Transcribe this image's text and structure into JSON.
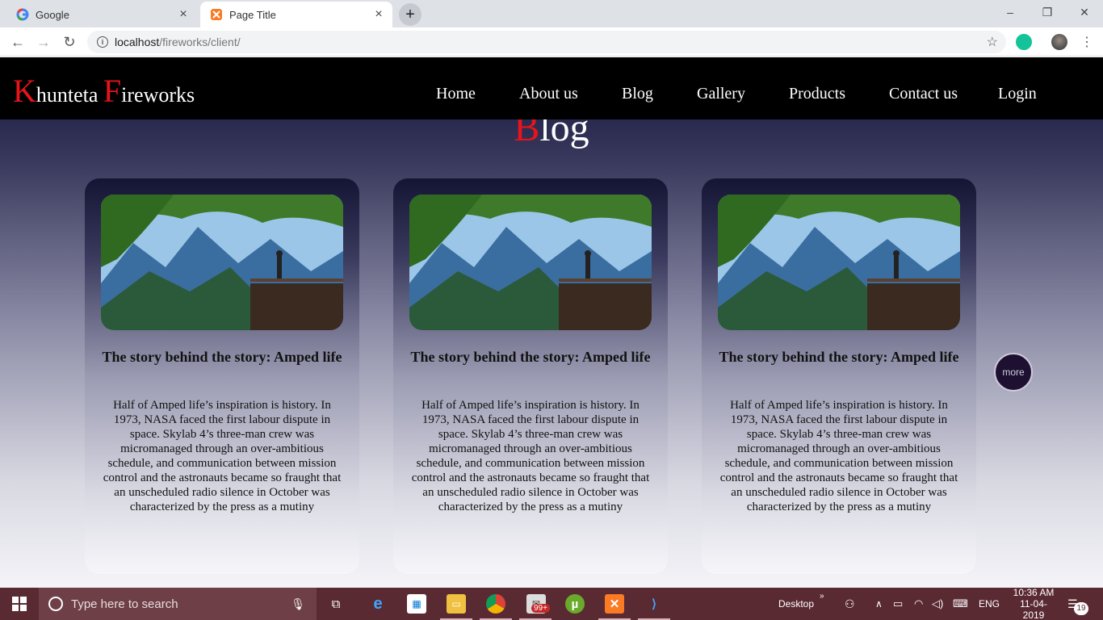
{
  "browser": {
    "tabs": [
      {
        "title": "Google",
        "favicon": "google-favicon",
        "close": "×"
      },
      {
        "title": "Page Title",
        "favicon": "xampp-favicon",
        "close": "×"
      }
    ],
    "new_tab": "+",
    "address": {
      "host": "localhost",
      "path": "/fireworks/client/"
    },
    "window_controls": {
      "minimize": "–",
      "restore": "❐",
      "close": "✕"
    }
  },
  "site": {
    "brand": {
      "k": "K",
      "rest1": "hunteta ",
      "f": "F",
      "rest2": "ireworks"
    },
    "nav": [
      "Home",
      "About us",
      "Blog",
      "Gallery",
      "Products",
      "Contact us",
      "Login"
    ],
    "section_title": {
      "first": "B",
      "rest": "log"
    },
    "cards": [
      {
        "title": "The story behind the story: Amped life",
        "body": "Half of Amped life’s inspiration is history. In 1973, NASA faced the first labour dispute in space. Skylab 4’s three-man crew was micromanaged through an over-ambitious schedule, and communication between mission control and the astronauts became so fraught that an unscheduled radio silence in October was characterized by the press as a mutiny"
      },
      {
        "title": "The story behind the story: Amped life",
        "body": "Half of Amped life’s inspiration is history. In 1973, NASA faced the first labour dispute in space. Skylab 4’s three-man crew was micromanaged through an over-ambitious schedule, and communication between mission control and the astronauts became so fraught that an unscheduled radio silence in October was characterized by the press as a mutiny"
      },
      {
        "title": "The story behind the story: Amped life",
        "body": "Half of Amped life’s inspiration is history. In 1973, NASA faced the first labour dispute in space. Skylab 4’s three-man crew was micromanaged through an over-ambitious schedule, and communication between mission control and the astronauts became so fraught that an unscheduled radio silence in October was characterized by the press as a mutiny"
      }
    ],
    "more_label": "more",
    "colors": {
      "accent": "#e8141b",
      "header_bg": "#000000"
    }
  },
  "taskbar": {
    "search_placeholder": "Type here to search",
    "desktop_label": "Desktop",
    "language": "ENG",
    "time": "10:36 AM",
    "date": "11-04-2019",
    "mail_badge": "99+",
    "notification_count": "19"
  }
}
